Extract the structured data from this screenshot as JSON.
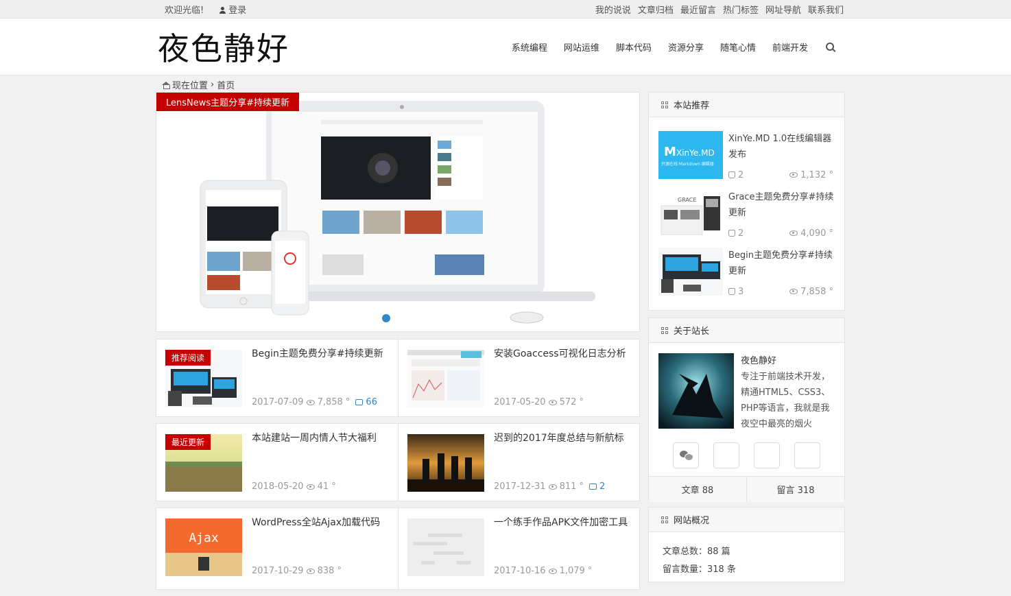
{
  "topbar": {
    "welcome": "欢迎光临!",
    "login": "登录",
    "links": [
      "我的说说",
      "文章归档",
      "最近留言",
      "热门标签",
      "网址导航",
      "联系我们"
    ]
  },
  "header": {
    "logo": "夜色静好",
    "nav": [
      "系统编程",
      "网站运维",
      "脚本代码",
      "资源分享",
      "随笔心情",
      "前端开发"
    ]
  },
  "breadcrumb": {
    "label": "现在位置",
    "sep": "›",
    "current": "首页"
  },
  "slider": {
    "tag": "LensNews主题分享#持续更新"
  },
  "articles": [
    {
      "tag": "推荐阅读",
      "title": "Begin主题免费分享#持续更新",
      "date": "2017-07-09",
      "views": "7,858 °",
      "comments": "66"
    },
    {
      "tag": "",
      "title": "安装Goaccess可视化日志分析",
      "date": "2017-05-20",
      "views": "572 °",
      "comments": ""
    },
    {
      "tag": "最近更新",
      "title": "本站建站一周内情人节大福利",
      "date": "2018-05-20",
      "views": "41 °",
      "comments": ""
    },
    {
      "tag": "",
      "title": "迟到的2017年度总结与新航标",
      "date": "2017-12-31",
      "views": "811 °",
      "comments": "2"
    },
    {
      "tag": "",
      "title": "WordPress全站Ajax加载代码",
      "date": "2017-10-29",
      "views": "838 °",
      "comments": ""
    },
    {
      "tag": "",
      "title": "一个练手作品APK文件加密工具",
      "date": "2017-10-16",
      "views": "1,079 °",
      "comments": ""
    }
  ],
  "recommend": {
    "title": "本站推荐",
    "items": [
      {
        "title": "XinYe.MD 1.0在线编辑器发布",
        "likes": "2",
        "views": "1,132 °",
        "thumb_text": "XinYe.MD",
        "thumb_sub": "开源在线 Markdown 编辑器"
      },
      {
        "title": "Grace主题免费分享#持续更新",
        "likes": "2",
        "views": "4,090 °",
        "thumb_text": "GRACE"
      },
      {
        "title": "Begin主题免费分享#持续更新",
        "likes": "3",
        "views": "7,858 °"
      }
    ]
  },
  "about": {
    "title": "关于站长",
    "name": "夜色静好",
    "bio": "专注于前端技术开发，精通HTML5、CSS3、PHP等语言，我就是我夜空中最亮的烟火",
    "articles": "文章 88",
    "comments": "留言 318"
  },
  "overview": {
    "title": "网站概况",
    "lines": [
      "文章总数：88 篇",
      "留言数量：318 条"
    ]
  },
  "colors": {
    "accent_red": "#c40000",
    "link_blue": "#2f86c8"
  }
}
